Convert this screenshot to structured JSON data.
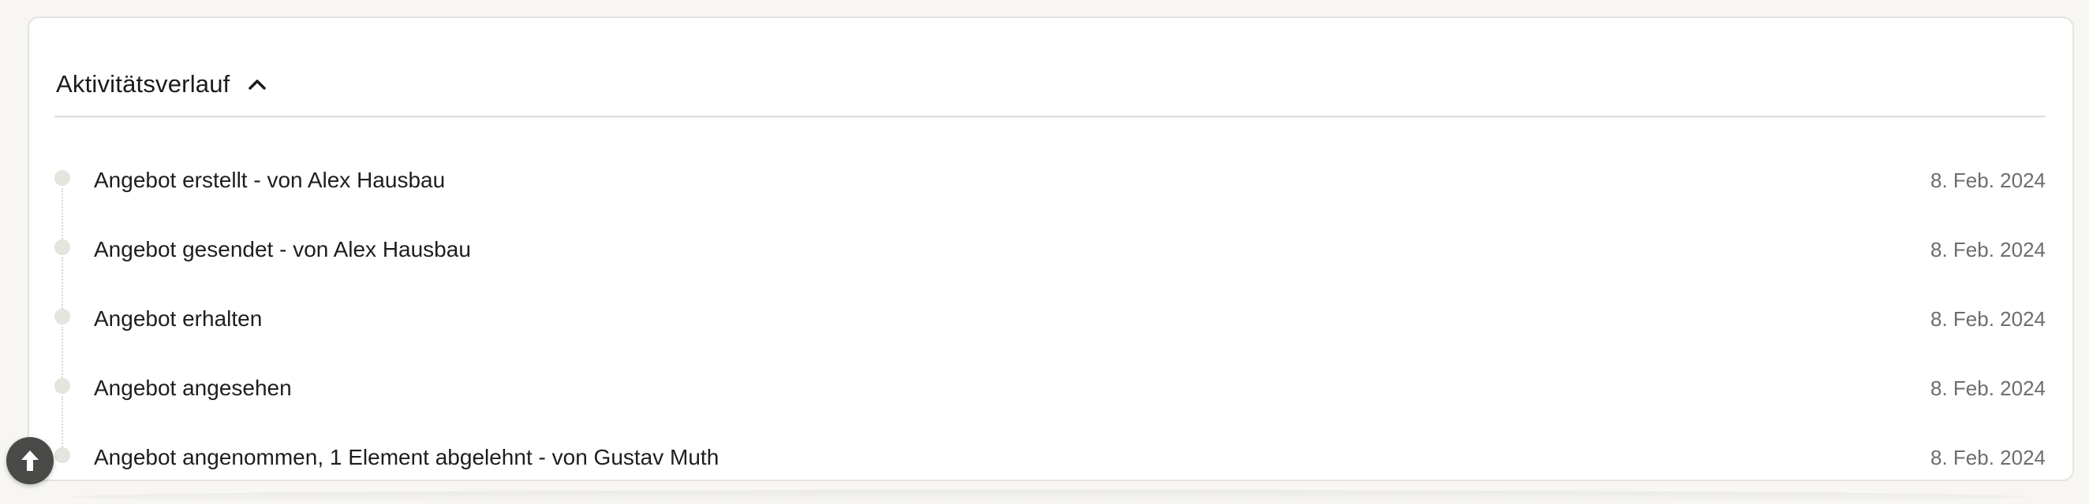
{
  "section": {
    "title": "Aktivitätsverlauf",
    "toggle_icon": "chevron-up-icon"
  },
  "activities": [
    {
      "label": "Angebot erstellt - von Alex Hausbau",
      "date": "8. Feb. 2024"
    },
    {
      "label": "Angebot gesendet - von Alex Hausbau",
      "date": "8. Feb. 2024"
    },
    {
      "label": "Angebot erhalten",
      "date": "8. Feb. 2024"
    },
    {
      "label": "Angebot angesehen",
      "date": "8. Feb. 2024"
    },
    {
      "label": "Angebot angenommen, 1 Element abgelehnt - von Gustav Muth",
      "date": "8. Feb. 2024"
    }
  ],
  "scroll_top_button": {
    "icon": "arrow-up-icon"
  },
  "colors": {
    "card_background": "#ffffff",
    "page_background": "#f7f6f3",
    "timeline_dot": "#e5e4de",
    "date_text": "#6d6d6a",
    "fab_background": "#4a4a48"
  }
}
